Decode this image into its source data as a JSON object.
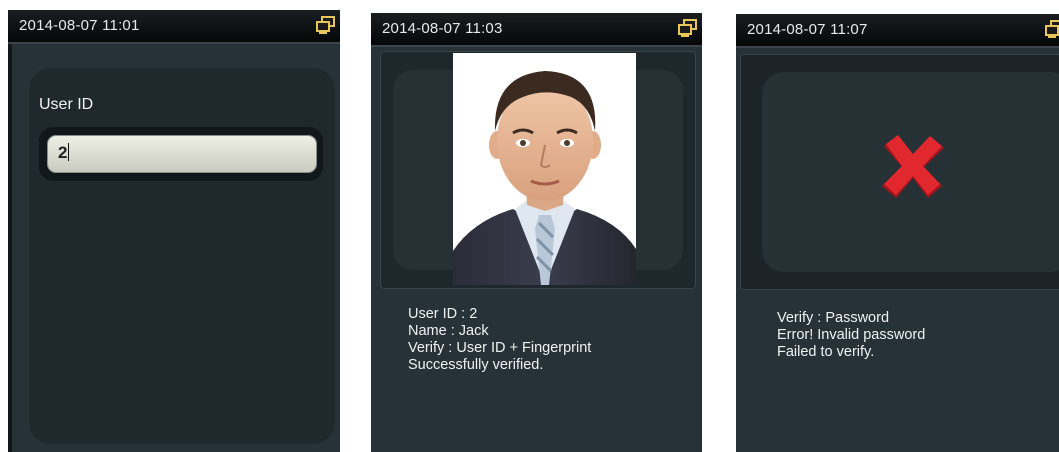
{
  "screens": [
    {
      "clock": "2014-08-07 11:01",
      "field_label": "User ID",
      "field_value": "2"
    },
    {
      "clock": "2014-08-07 11:03",
      "info_lines": [
        "User ID : 2",
        "Name : Jack",
        "Verify : User ID + Fingerprint",
        "Successfully verified."
      ]
    },
    {
      "clock": "2014-08-07 11:07",
      "info_lines": [
        "Verify : Password",
        "Error! Invalid password",
        "Failed to verify."
      ]
    }
  ],
  "icons": {
    "status": "network-icon",
    "result": "red-x-icon"
  },
  "colors": {
    "screen_bg": "#263238",
    "error_red": "#d8232a"
  }
}
